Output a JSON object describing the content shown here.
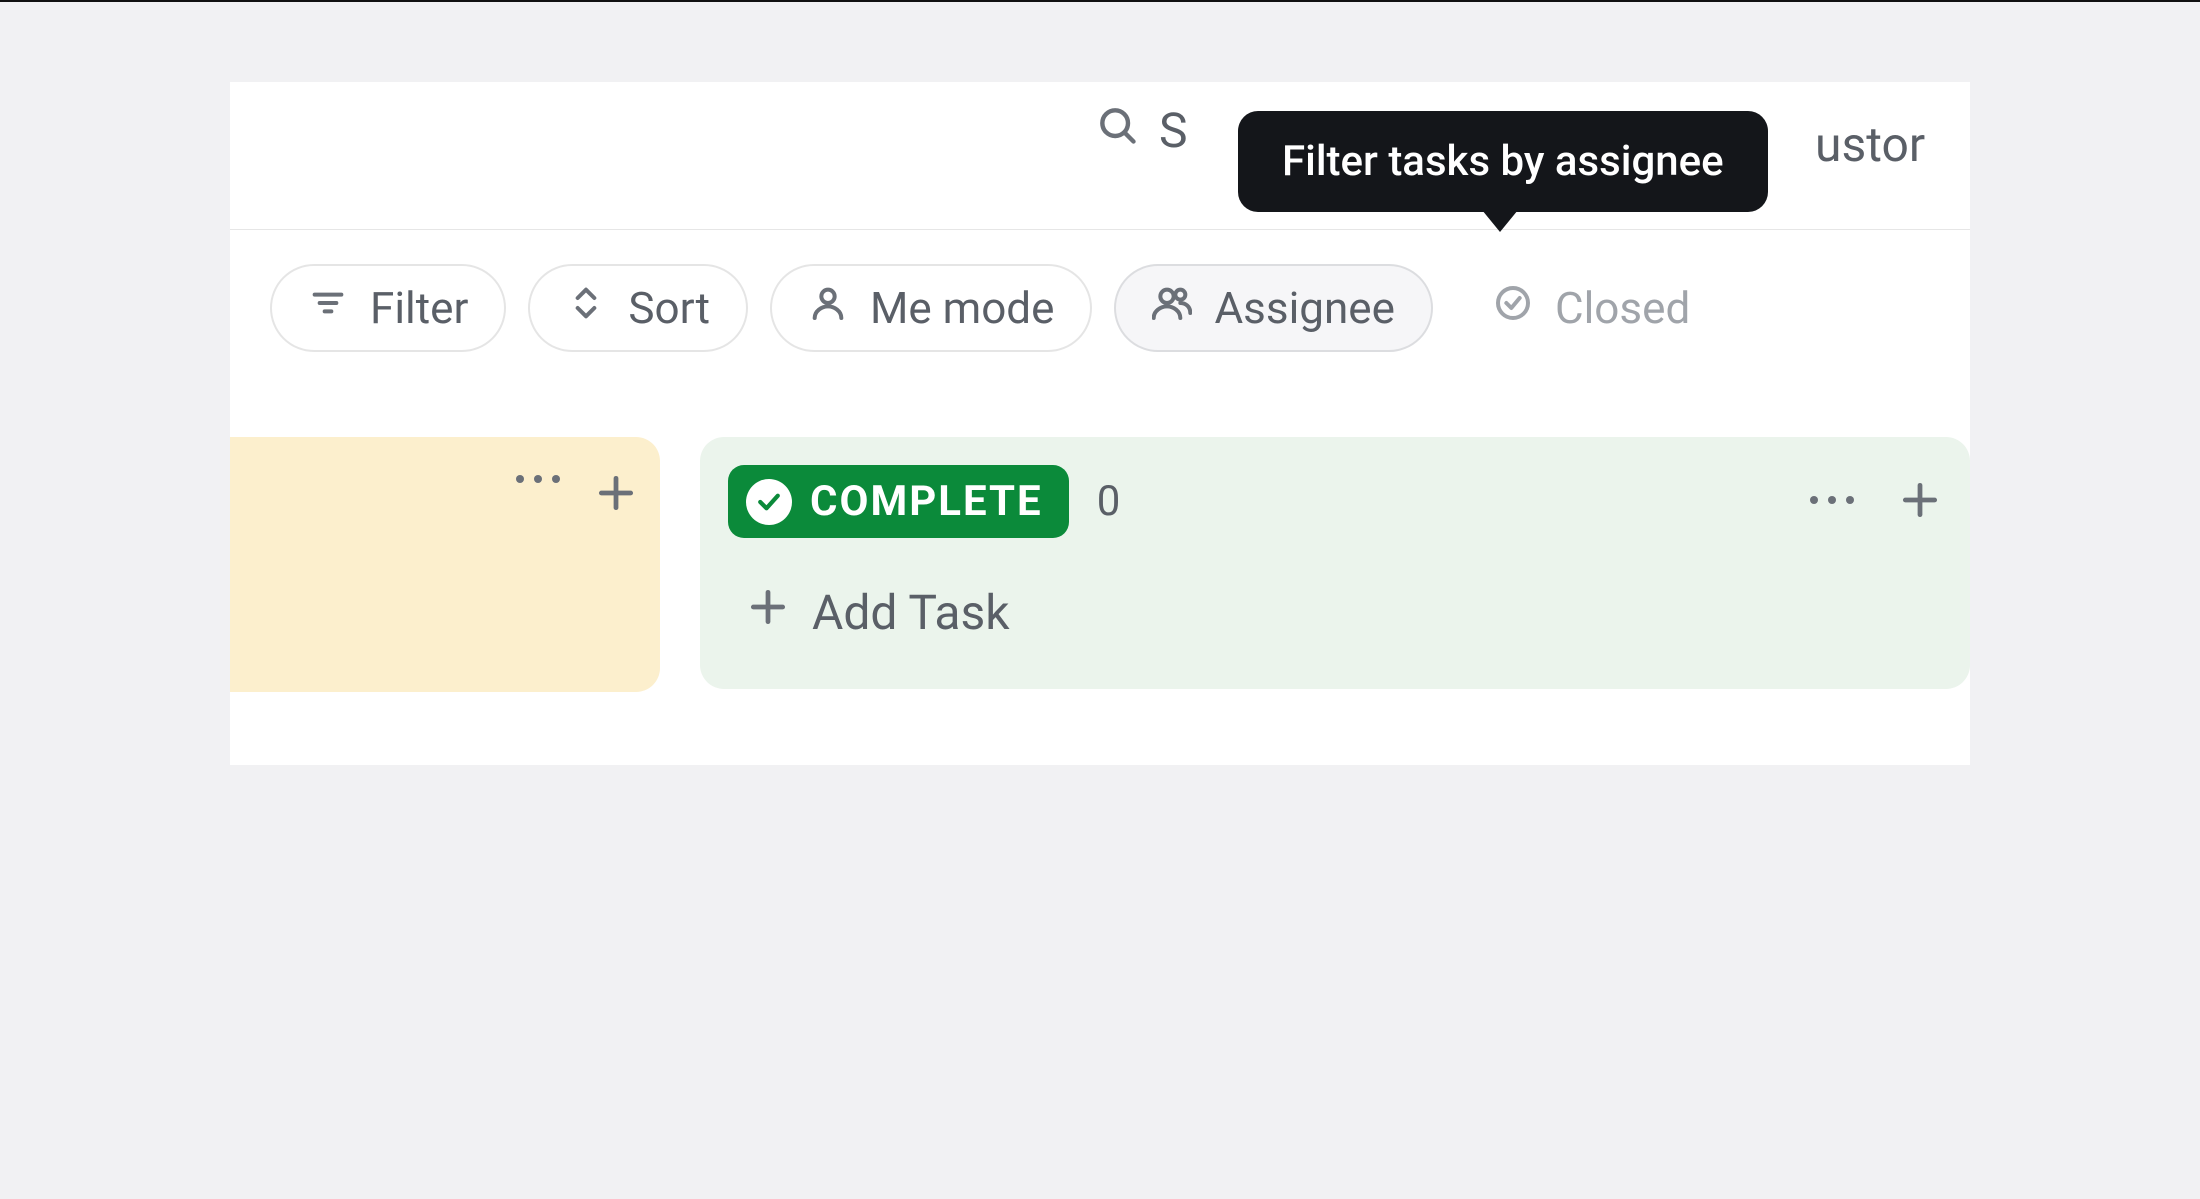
{
  "top": {
    "search_partial": "S",
    "customize_partial": "ustor"
  },
  "tooltip": {
    "text": "Filter tasks by assignee"
  },
  "filters": {
    "filter_label": "Filter",
    "sort_label": "Sort",
    "me_mode_label": "Me mode",
    "assignee_label": "Assignee",
    "closed_label": "Closed"
  },
  "columns": {
    "complete": {
      "badge": "COMPLETE",
      "count": "0",
      "add_task_label": "Add Task"
    }
  }
}
